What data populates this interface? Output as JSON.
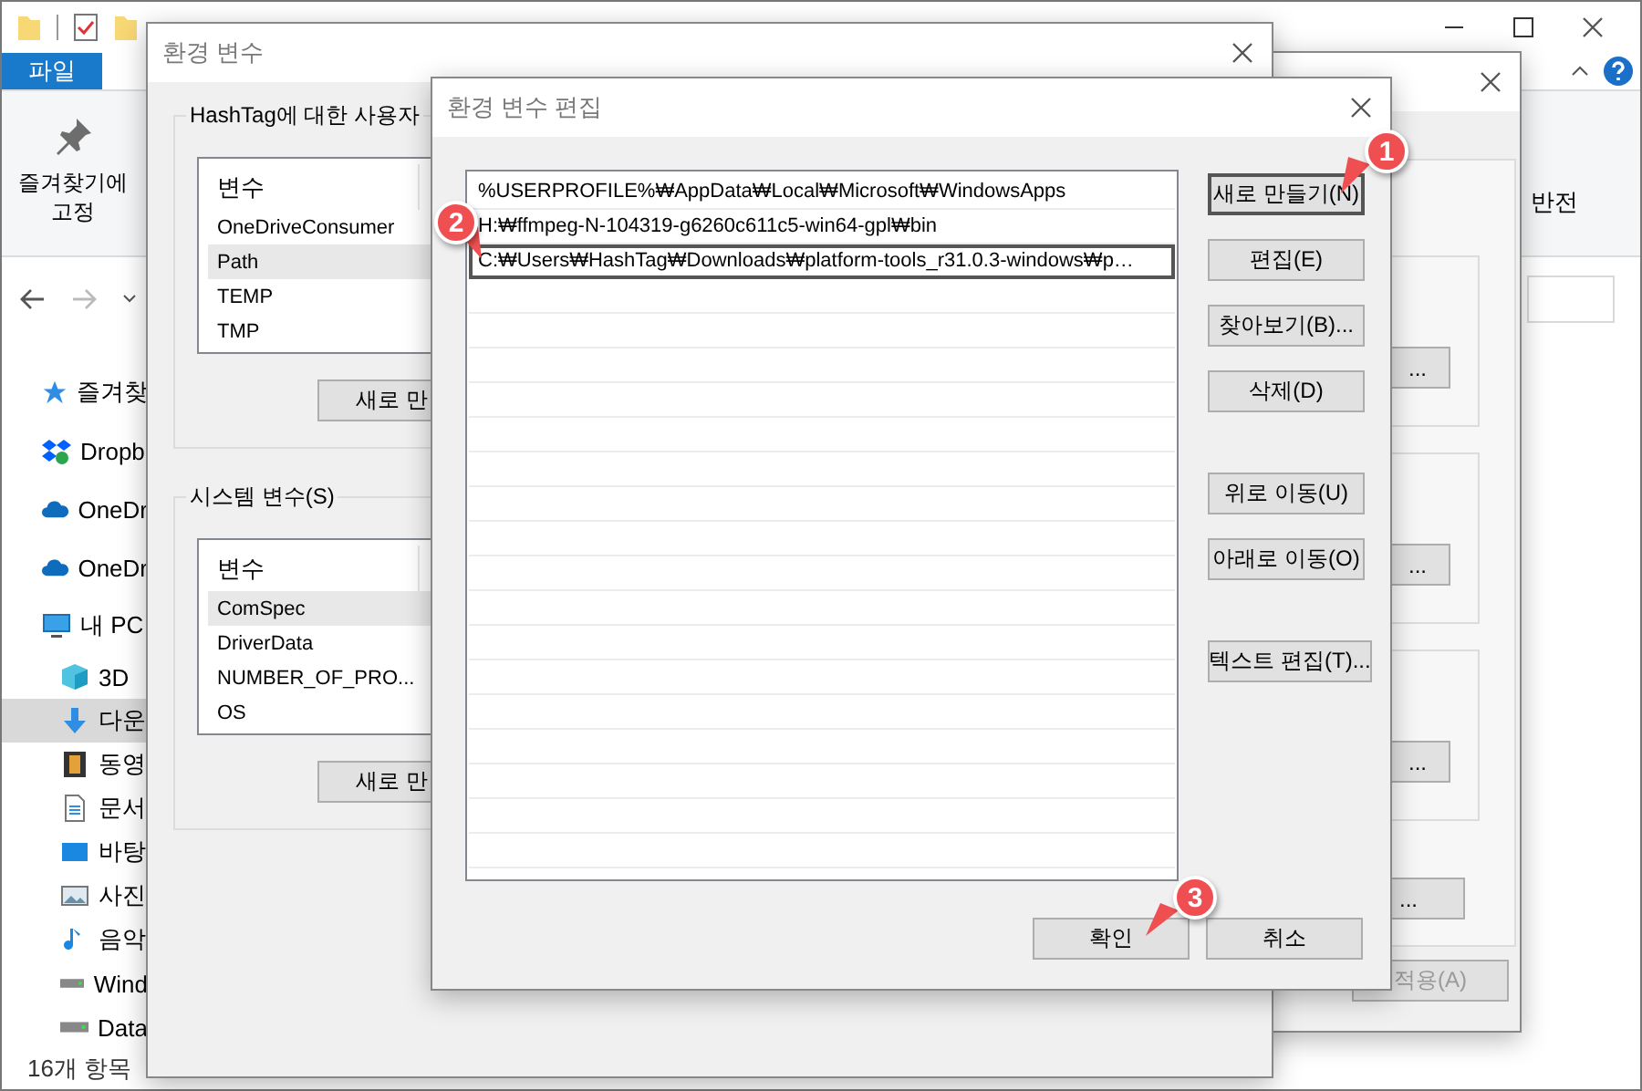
{
  "explorer": {
    "ribbon_tabs": [
      {
        "label": "파일",
        "selected": true
      }
    ],
    "pin_button": [
      "즐겨찾기에",
      "고정"
    ],
    "ribbon_fragment": "반전",
    "sidebar": [
      {
        "label": "즐겨찾",
        "kind": "star",
        "selected": false
      },
      {
        "label": "Dropb",
        "kind": "dropbox",
        "selected": false
      },
      {
        "label": "OneDr",
        "kind": "cloud",
        "selected": false
      },
      {
        "label": "OneDr",
        "kind": "cloud",
        "selected": false
      },
      {
        "label": "내 PC",
        "kind": "pc",
        "selected": false,
        "children": [
          {
            "label": "3D",
            "kind": "cube",
            "selected": false
          },
          {
            "label": "다운",
            "kind": "download",
            "selected": true
          },
          {
            "label": "동영",
            "kind": "film",
            "selected": false
          },
          {
            "label": "문서",
            "kind": "document",
            "selected": false
          },
          {
            "label": "바탕",
            "kind": "desktop",
            "selected": false
          },
          {
            "label": "사진",
            "kind": "photo",
            "selected": false
          },
          {
            "label": "음악",
            "kind": "music",
            "selected": false
          },
          {
            "label": "Wind",
            "kind": "drive",
            "selected": false
          },
          {
            "label": "Data",
            "kind": "drive",
            "selected": false
          }
        ]
      }
    ],
    "status": "16개 항목"
  },
  "back_dialog": {
    "buttons": [
      "...",
      "...",
      "..."
    ],
    "footer_buttons": [
      {
        "label": "...",
        "disabled": false
      },
      {
        "label": "적용(A)",
        "disabled": true
      }
    ]
  },
  "env_dialog": {
    "title": "환경 변수",
    "groups": [
      {
        "title": "HashTag에 대한 사용자",
        "header": "변수",
        "button": "새로 만",
        "rows": [
          {
            "name": "OneDriveConsumer",
            "selected": false
          },
          {
            "name": "Path",
            "selected": true
          },
          {
            "name": "TEMP",
            "selected": false
          },
          {
            "name": "TMP",
            "selected": false
          }
        ]
      },
      {
        "title": "시스템 변수(S)",
        "header": "변수",
        "button": "새로 만",
        "rows": [
          {
            "name": "ComSpec",
            "selected": true
          },
          {
            "name": "DriverData",
            "selected": false
          },
          {
            "name": "NUMBER_OF_PRO...",
            "selected": false
          },
          {
            "name": "OS",
            "selected": false
          }
        ]
      }
    ]
  },
  "edit_dialog": {
    "title": "환경 변수 편집",
    "entries": [
      {
        "text": "%USERPROFILE%₩AppData₩Local₩Microsoft₩WindowsApps",
        "selected": false
      },
      {
        "text": "H:₩ffmpeg-N-104319-g6260c611c5-win64-gpl₩bin",
        "selected": false
      },
      {
        "text": "C:₩Users₩HashTag₩Downloads₩platform-tools_r31.0.3-windows₩p…",
        "selected": true
      }
    ],
    "button_groups": [
      [
        {
          "label": "새로 만들기(N)",
          "default": true
        },
        {
          "label": "편집(E)",
          "default": false
        },
        {
          "label": "찾아보기(B)...",
          "default": false
        },
        {
          "label": "삭제(D)",
          "default": false
        }
      ],
      [
        {
          "label": "위로 이동(U)",
          "default": false
        },
        {
          "label": "아래로 이동(O)",
          "default": false
        }
      ],
      [
        {
          "label": "텍스트 편집(T)...",
          "default": false
        }
      ]
    ],
    "ok": "확인",
    "cancel": "취소"
  },
  "callouts": [
    "1",
    "2",
    "3"
  ]
}
